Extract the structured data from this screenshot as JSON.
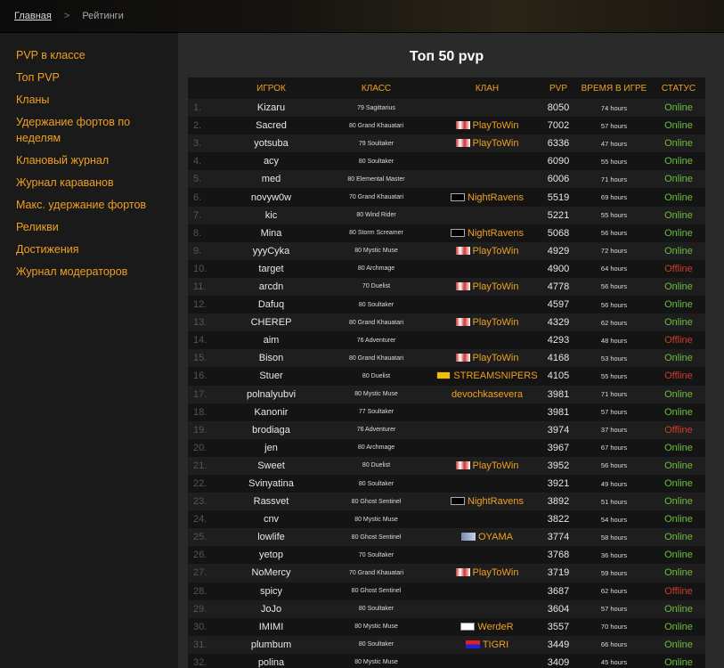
{
  "breadcrumb": {
    "home": "Главная",
    "separator": ">",
    "current": "Рейтинги"
  },
  "sidebar": {
    "items": [
      {
        "id": "pvp-class",
        "label": "PVP в классе"
      },
      {
        "id": "top-pvp",
        "label": "Топ PVP"
      },
      {
        "id": "clans",
        "label": "Кланы"
      },
      {
        "id": "forts-weeks-1",
        "label": "Удержание фортов по"
      },
      {
        "id": "forts-weeks-2",
        "label": "неделям"
      },
      {
        "id": "clan-journal",
        "label": "Клановый журнал"
      },
      {
        "id": "caravans",
        "label": "Журнал караванов"
      },
      {
        "id": "max-forts",
        "label": "Макс. удержание фортов"
      },
      {
        "id": "relics",
        "label": "Реликви"
      },
      {
        "id": "achievements",
        "label": "Достижения"
      },
      {
        "id": "moderators",
        "label": "Журнал модераторов"
      }
    ]
  },
  "page_title": "Топ 50 pvp",
  "table": {
    "headers": [
      "",
      "ИГРОК",
      "КЛАСС",
      "КЛАН",
      "PVP",
      "ВРЕМЯ В ИГРЕ",
      "СТАТУС"
    ],
    "rows": [
      {
        "num": "1.",
        "player": "Kizaru",
        "cls": "79 Sagittarius",
        "clan": "",
        "emblem": "",
        "pvp": "8050",
        "time": "74 hours",
        "status": "Online"
      },
      {
        "num": "2.",
        "player": "Sacred",
        "cls": "80 Grand Khauatari",
        "clan": "PlayToWin",
        "emblem": "ptw",
        "pvp": "7002",
        "time": "57 hours",
        "status": "Online"
      },
      {
        "num": "3.",
        "player": "yotsuba",
        "cls": "79 Soultaker",
        "clan": "PlayToWin",
        "emblem": "ptw",
        "pvp": "6336",
        "time": "47 hours",
        "status": "Online"
      },
      {
        "num": "4.",
        "player": "acy",
        "cls": "80 Soultaker",
        "clan": "",
        "emblem": "",
        "pvp": "6090",
        "time": "55 hours",
        "status": "Online"
      },
      {
        "num": "5.",
        "player": "med",
        "cls": "80 Elemental Master",
        "clan": "",
        "emblem": "",
        "pvp": "6006",
        "time": "71 hours",
        "status": "Online"
      },
      {
        "num": "6.",
        "player": "novyw0w",
        "cls": "70 Grand Khauatari",
        "clan": "NightRavens",
        "emblem": "nr",
        "pvp": "5519",
        "time": "69 hours",
        "status": "Online"
      },
      {
        "num": "7.",
        "player": "kic",
        "cls": "80 Wind Rider",
        "clan": "",
        "emblem": "",
        "pvp": "5221",
        "time": "55 hours",
        "status": "Online"
      },
      {
        "num": "8.",
        "player": "Mina",
        "cls": "80 Storm Screamer",
        "clan": "NightRavens",
        "emblem": "nr",
        "pvp": "5068",
        "time": "56 hours",
        "status": "Online"
      },
      {
        "num": "9.",
        "player": "yyyCyka",
        "cls": "80 Mystic Muse",
        "clan": "PlayToWin",
        "emblem": "ptw",
        "pvp": "4929",
        "time": "72 hours",
        "status": "Online"
      },
      {
        "num": "10.",
        "player": "target",
        "cls": "80 Archmage",
        "clan": "",
        "emblem": "",
        "pvp": "4900",
        "time": "64 hours",
        "status": "Offline"
      },
      {
        "num": "11.",
        "player": "arcdn",
        "cls": "70 Duelist",
        "clan": "PlayToWin",
        "emblem": "ptw",
        "pvp": "4778",
        "time": "56 hours",
        "status": "Online"
      },
      {
        "num": "12.",
        "player": "Dafuq",
        "cls": "80 Soultaker",
        "clan": "",
        "emblem": "",
        "pvp": "4597",
        "time": "56 hours",
        "status": "Online"
      },
      {
        "num": "13.",
        "player": "CHEREP",
        "cls": "80 Grand Khauatari",
        "clan": "PlayToWin",
        "emblem": "ptw",
        "pvp": "4329",
        "time": "62 hours",
        "status": "Online"
      },
      {
        "num": "14.",
        "player": "aim",
        "cls": "76 Adventurer",
        "clan": "",
        "emblem": "",
        "pvp": "4293",
        "time": "48 hours",
        "status": "Offline"
      },
      {
        "num": "15.",
        "player": "Bison",
        "cls": "80 Grand Khauatari",
        "clan": "PlayToWin",
        "emblem": "ptw",
        "pvp": "4168",
        "time": "53 hours",
        "status": "Online"
      },
      {
        "num": "16.",
        "player": "Stuer",
        "cls": "80 Duelist",
        "clan": "STREAMSNIPERS",
        "emblem": "ss",
        "pvp": "4105",
        "time": "55 hours",
        "status": "Offline"
      },
      {
        "num": "17.",
        "player": "polnalyubvi",
        "cls": "80 Mystic Muse",
        "clan": "devochkasevera",
        "emblem": "",
        "pvp": "3981",
        "time": "71 hours",
        "status": "Online"
      },
      {
        "num": "18.",
        "player": "Kanonir",
        "cls": "77 Soultaker",
        "clan": "",
        "emblem": "",
        "pvp": "3981",
        "time": "57 hours",
        "status": "Online"
      },
      {
        "num": "19.",
        "player": "brodiaga",
        "cls": "76 Adventurer",
        "clan": "",
        "emblem": "",
        "pvp": "3974",
        "time": "37 hours",
        "status": "Offline"
      },
      {
        "num": "20.",
        "player": "jen",
        "cls": "80 Archmage",
        "clan": "",
        "emblem": "",
        "pvp": "3967",
        "time": "67 hours",
        "status": "Online"
      },
      {
        "num": "21.",
        "player": "Sweet",
        "cls": "80 Duelist",
        "clan": "PlayToWin",
        "emblem": "ptw",
        "pvp": "3952",
        "time": "56 hours",
        "status": "Online"
      },
      {
        "num": "22.",
        "player": "Svinyatina",
        "cls": "80 Soultaker",
        "clan": "",
        "emblem": "",
        "pvp": "3921",
        "time": "49 hours",
        "status": "Online"
      },
      {
        "num": "23.",
        "player": "Rassvet",
        "cls": "80 Ghost Sentinel",
        "clan": "NightRavens",
        "emblem": "nr",
        "pvp": "3892",
        "time": "51 hours",
        "status": "Online"
      },
      {
        "num": "24.",
        "player": "cnv",
        "cls": "80 Mystic Muse",
        "clan": "",
        "emblem": "",
        "pvp": "3822",
        "time": "54 hours",
        "status": "Online"
      },
      {
        "num": "25.",
        "player": "lowlife",
        "cls": "80 Ghost Sentinel",
        "clan": "OYAMA",
        "emblem": "oy",
        "pvp": "3774",
        "time": "58 hours",
        "status": "Online"
      },
      {
        "num": "26.",
        "player": "yetop",
        "cls": "70 Soultaker",
        "clan": "",
        "emblem": "",
        "pvp": "3768",
        "time": "36 hours",
        "status": "Online"
      },
      {
        "num": "27.",
        "player": "NoMercy",
        "cls": "70 Grand Khauatari",
        "clan": "PlayToWin",
        "emblem": "ptw",
        "pvp": "3719",
        "time": "59 hours",
        "status": "Online"
      },
      {
        "num": "28.",
        "player": "spicy",
        "cls": "80 Ghost Sentinel",
        "clan": "",
        "emblem": "",
        "pvp": "3687",
        "time": "62 hours",
        "status": "Offline"
      },
      {
        "num": "29.",
        "player": "JoJo",
        "cls": "80 Soultaker",
        "clan": "",
        "emblem": "",
        "pvp": "3604",
        "time": "57 hours",
        "status": "Online"
      },
      {
        "num": "30.",
        "player": "IMIMI",
        "cls": "80 Mystic Muse",
        "clan": "WerdeR",
        "emblem": "wd",
        "pvp": "3557",
        "time": "70 hours",
        "status": "Online"
      },
      {
        "num": "31.",
        "player": "plumbum",
        "cls": "80 Soultaker",
        "clan": "TIGRI",
        "emblem": "tg",
        "pvp": "3449",
        "time": "66 hours",
        "status": "Online"
      },
      {
        "num": "32.",
        "player": "polina",
        "cls": "80 Mystic Muse",
        "clan": "",
        "emblem": "",
        "pvp": "3409",
        "time": "45 hours",
        "status": "Online"
      }
    ]
  }
}
